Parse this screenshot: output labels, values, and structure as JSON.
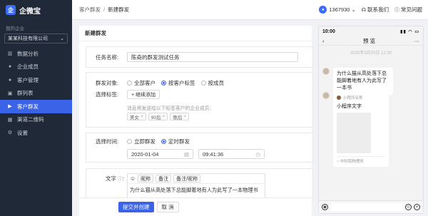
{
  "app": {
    "name": "企微宝",
    "logo_char": "企"
  },
  "sidebar": {
    "org_label": "我的企业",
    "org_name": "某某科技有限公司",
    "items": [
      {
        "label": "数据分析",
        "icon": "bar-chart-icon"
      },
      {
        "label": "企业成员",
        "icon": "user-icon"
      },
      {
        "label": "客户管理",
        "icon": "user-icon"
      },
      {
        "label": "群列表",
        "icon": "group-icon"
      },
      {
        "label": "客户群发",
        "icon": "send-icon",
        "active": true
      },
      {
        "label": "渠道二维码",
        "icon": "qrcode-icon"
      },
      {
        "label": "设置",
        "icon": "gear-icon"
      }
    ]
  },
  "header": {
    "breadcrumb": [
      "客户群发",
      "新建群发"
    ],
    "user_id": "1367930",
    "feedback": "联系我们",
    "faq": "常见问题"
  },
  "form": {
    "title": "新建群发",
    "task_name_label": "任务名称:",
    "task_name_value": "陈奇的群发测试任务",
    "target_label": "群发对象:",
    "target_options": [
      "全部客户",
      "按客户标签",
      "按成员"
    ],
    "target_selected": "按客户标签",
    "tag_label": "选择标签:",
    "add_tag_button": "+ 继续添加",
    "tag_hint": "消息将发送给以下标签客户的企业成员：",
    "tags": [
      "美女",
      "90后",
      "歌后"
    ],
    "time_label": "选择时间:",
    "time_options": [
      "立即群发",
      "定时群发"
    ],
    "time_selected": "定时群发",
    "date_value": "2020-01-04",
    "time_value": "09:41:36",
    "text_label": "文字",
    "insert_buttons": [
      "昵称",
      "备注",
      "备注/昵称"
    ],
    "text_value": "为什么猫从高处落下总能脚着地有人为此写了一本物理书",
    "submit_button": "提交并创建",
    "cancel_button": "取 消"
  },
  "preview": {
    "status_time": "10:00",
    "nav_title": "预 览",
    "timestamp": "2020年3月20日 12:30",
    "message_text": "为什么猫从高处落下总能脚着地有人为此写了一本书",
    "mini_program_name": "小程序名称",
    "mini_program_title": "小程序文字",
    "mini_program_footer": "中科院物理所"
  },
  "colors": {
    "accent": "#3a63e8",
    "sidebar_bg": "#1f2937"
  }
}
